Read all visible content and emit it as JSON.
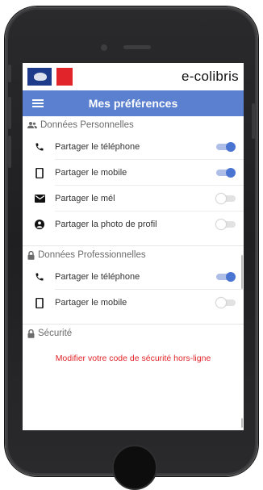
{
  "brand": {
    "name": "e-colibris"
  },
  "header": {
    "title": "Mes préférences"
  },
  "sections": [
    {
      "title": "Données Personnelles",
      "rows": [
        {
          "icon": "phone-icon",
          "label": "Partager le téléphone",
          "enabled": true
        },
        {
          "icon": "mobile-icon",
          "label": "Partager le mobile",
          "enabled": true
        },
        {
          "icon": "mail-icon",
          "label": "Partager le mél",
          "enabled": false
        },
        {
          "icon": "account-icon",
          "label": "Partager la photo de profil",
          "enabled": false
        }
      ]
    },
    {
      "title": "Données Professionnelles",
      "rows": [
        {
          "icon": "phone-icon",
          "label": "Partager le téléphone",
          "enabled": true
        },
        {
          "icon": "mobile-icon",
          "label": "Partager le mobile",
          "enabled": false
        }
      ]
    },
    {
      "title": "Sécurité",
      "link": "Modifier votre code de sécurité hors-ligne"
    }
  ],
  "colors": {
    "header_bg": "#5b80cf",
    "toggle_on": "#4a74d1",
    "link": "#e0242a"
  }
}
